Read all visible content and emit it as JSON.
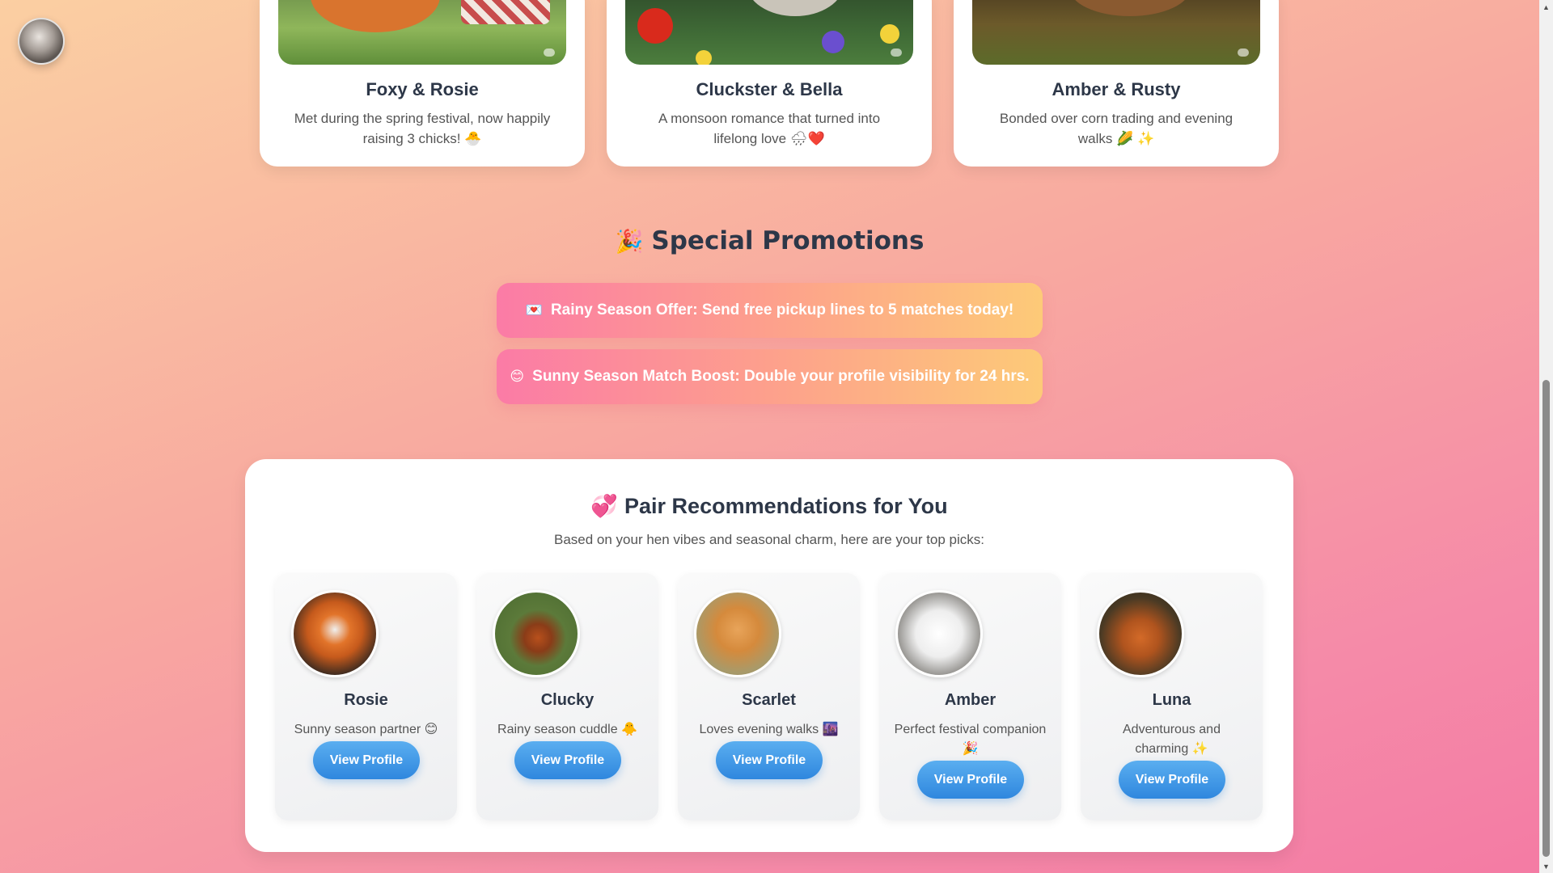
{
  "stories": [
    {
      "title": "Foxy & Rosie",
      "desc": "Met during the spring festival, now happily raising 3 chicks! 🐣"
    },
    {
      "title": "Cluckster & Bella",
      "desc": "A monsoon romance that turned into lifelong love 🌧❤️"
    },
    {
      "title": "Amber & Rusty",
      "desc": "Bonded over corn trading and evening walks 🌽 ✨"
    }
  ],
  "promotions": {
    "heading_emoji": "🎉",
    "heading": "Special Promotions",
    "items": [
      {
        "emoji": "💌",
        "text": "Rainy Season Offer: Send free pickup lines to 5 matches today!"
      },
      {
        "emoji": "😊",
        "text": "Sunny Season Match Boost: Double your profile visibility for 24 hrs."
      }
    ]
  },
  "recommendations": {
    "title_emoji": "💞",
    "title": "Pair Recommendations for You",
    "subtitle": "Based on your hen vibes and seasonal charm, here are your top picks:",
    "button_label": "View Profile",
    "profiles": [
      {
        "name": "Rosie",
        "desc": "Sunny season partner 😊"
      },
      {
        "name": "Clucky",
        "desc": "Rainy season cuddle 🐥"
      },
      {
        "name": "Scarlet",
        "desc": "Loves evening walks 🌆"
      },
      {
        "name": "Amber",
        "desc": "Perfect festival companion 🎉"
      },
      {
        "name": "Luna",
        "desc": "Adventurous and charming ✨"
      }
    ]
  }
}
